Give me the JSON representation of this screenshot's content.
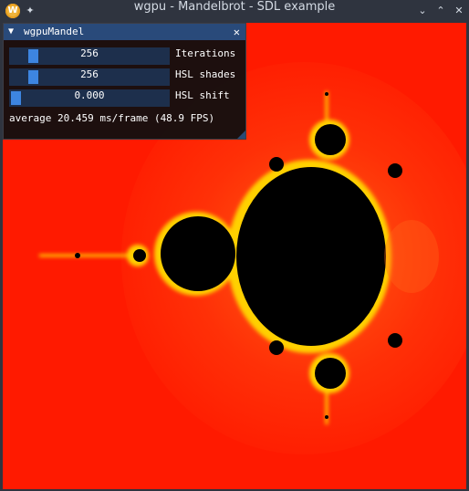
{
  "window": {
    "title": "wgpu - Mandelbrot - SDL example",
    "app_icon_letter": "W",
    "controls": {
      "minimize": "⌄",
      "maximize": "⌃",
      "close": "✕"
    }
  },
  "imgui": {
    "title": "wgpuMandel",
    "sliders": [
      {
        "value": "256",
        "label": "Iterations",
        "level": 0.12
      },
      {
        "value": "256",
        "label": "HSL shades",
        "level": 0.12
      },
      {
        "value": "0.000",
        "label": "HSL shift",
        "level": 0.0
      }
    ],
    "stats": "average 20.459 ms/frame (48.9 FPS)"
  },
  "colors": {
    "background_red": "#ff1a00",
    "set_black": "#000000",
    "glow_yellow": "#ffe000",
    "imgui_title": "#294a7a",
    "slider_bg": "#1d2f4c",
    "slider_grab": "#3d85e0"
  }
}
